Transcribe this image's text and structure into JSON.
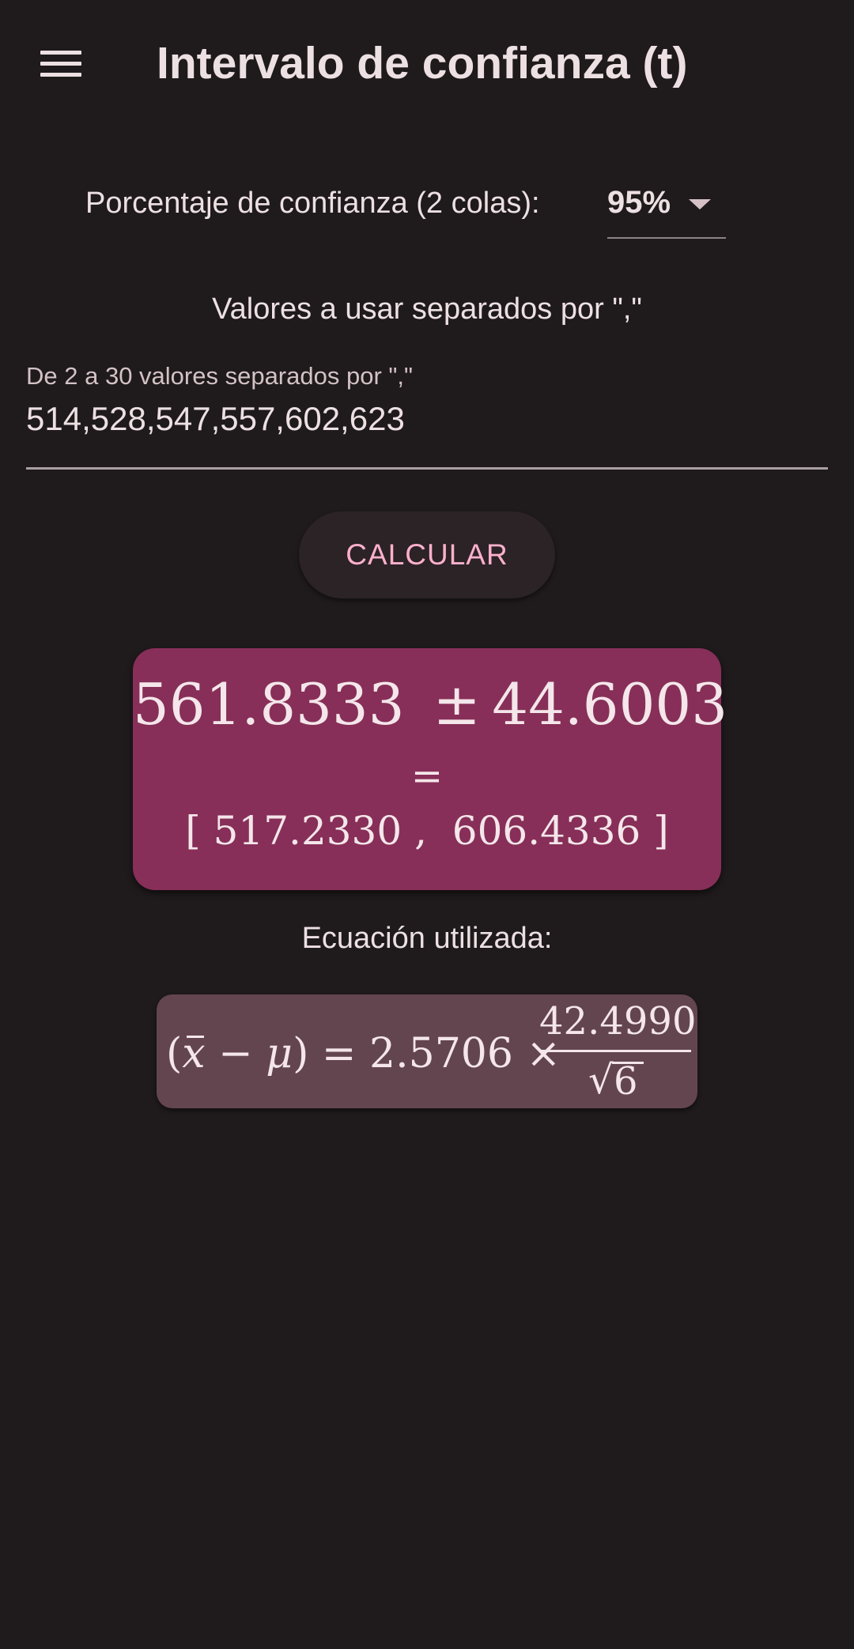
{
  "appbar": {
    "title": "Intervalo de confianza (t)",
    "menu_icon": "hamburger-menu-icon"
  },
  "confidence": {
    "label": "Porcentaje de confianza (2 colas):",
    "selected": "95%",
    "dropdown_icon": "caret-down-icon"
  },
  "values": {
    "heading": "Valores a usar separados por \",\"",
    "field_label": "De 2 a 30 valores separados por \",\"",
    "field_value": "514,528,547,557,602,623"
  },
  "calculate_button": "CALCULAR",
  "result": {
    "mean": "561.8333",
    "pm_sign": "±",
    "margin": "44.6003",
    "equals": "=",
    "open_bracket": "[",
    "lower": "517.2330",
    "comma": ",",
    "upper": "606.4336",
    "close_bracket": "]"
  },
  "equation": {
    "heading": "Ecuación utilizada:",
    "open_paren": "(",
    "x": "x",
    "minus": "−",
    "mu": "μ",
    "close_paren": ")",
    "equals": "=",
    "t_value": "2.5706",
    "times": "×",
    "numerator": "42.4990",
    "sqrt_sign": "√",
    "denominator": "6"
  },
  "colors": {
    "background": "#1f1a1c",
    "result_card": "#872f58",
    "equation_card": "#634550",
    "button_text": "#ffb0cc"
  }
}
